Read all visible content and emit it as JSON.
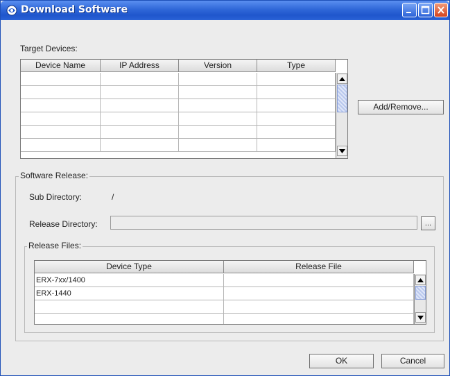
{
  "window": {
    "title": "Download Software"
  },
  "target_devices": {
    "label": "Target Devices:",
    "columns": [
      "Device Name",
      "IP Address",
      "Version",
      "Type"
    ],
    "row_count": 6
  },
  "add_remove_label": "Add/Remove...",
  "software_release": {
    "label": "Software Release:",
    "sub_directory_label": "Sub Directory:",
    "sub_directory_value": "/",
    "release_directory_label": "Release Directory:",
    "release_directory_value": "",
    "browse_label": "...",
    "release_files": {
      "label": "Release Files:",
      "columns": [
        "Device Type",
        "Release File"
      ],
      "rows": [
        [
          "ERX-7xx/1400",
          ""
        ],
        [
          "ERX-1440",
          ""
        ],
        [
          "",
          ""
        ],
        [
          "",
          ""
        ]
      ]
    }
  },
  "ok_label": "OK",
  "cancel_label": "Cancel"
}
